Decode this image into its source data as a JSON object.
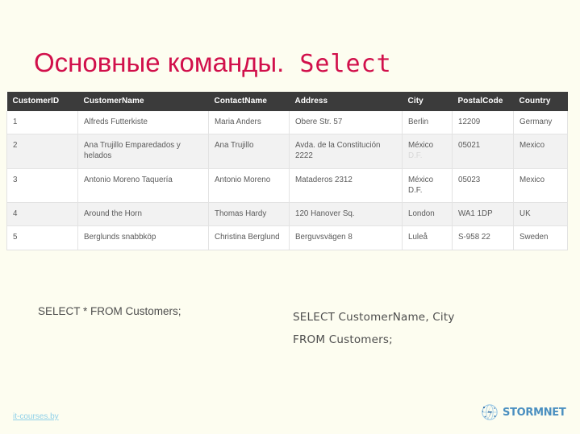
{
  "slide": {
    "background_color": "#fdfdf0",
    "title_ru": "Основные команды.",
    "title_mono": " Select",
    "title_color": "#d1104b"
  },
  "table": {
    "header_bg": "#3b3b3b",
    "columns": [
      "CustomerID",
      "CustomerName",
      "ContactName",
      "Address",
      "City",
      "PostalCode",
      "Country"
    ],
    "rows": [
      {
        "customer_id": "1",
        "customer_name": "Alfreds Futterkiste",
        "contact_name": "Maria Anders",
        "address": "Obere Str. 57",
        "city": "Berlin",
        "city_second_line": "",
        "postal_code": "12209",
        "country": "Germany"
      },
      {
        "customer_id": "2",
        "customer_name": "Ana Trujillo Emparedados y helados",
        "contact_name": "Ana Trujillo",
        "address": "Avda. de la Constitución 2222",
        "city": "México",
        "city_second_line": "D.F.",
        "postal_code": "05021",
        "country": "Mexico"
      },
      {
        "customer_id": "3",
        "customer_name": "Antonio Moreno Taquería",
        "contact_name": "Antonio Moreno",
        "address": "Mataderos 2312",
        "city": "México",
        "city_second_line": "D.F.",
        "postal_code": "05023",
        "country": "Mexico"
      },
      {
        "customer_id": "4",
        "customer_name": "Around the Horn",
        "contact_name": "Thomas Hardy",
        "address": "120 Hanover Sq.",
        "city": "London",
        "city_second_line": "",
        "postal_code": "WA1 1DP",
        "country": "UK"
      },
      {
        "customer_id": "5",
        "customer_name": "Berglunds snabbköp",
        "contact_name": "Christina Berglund",
        "address": "Berguvsvägen 8",
        "city": "Luleå",
        "city_second_line": "",
        "postal_code": "S-958 22",
        "country": "Sweden"
      }
    ]
  },
  "sql": {
    "left": "SELECT * FROM Customers;",
    "right_line1": "SELECT CustomerName, City",
    "right_line2": "FROM Customers;"
  },
  "footer": {
    "link_text": "it-courses.by",
    "link_color": "#8fd0e8",
    "logo_text": "STORMNET",
    "logo_color": "#4a8fc0"
  }
}
